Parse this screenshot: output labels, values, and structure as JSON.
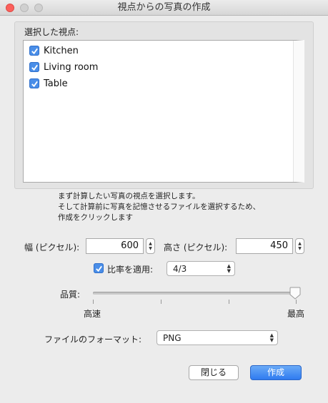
{
  "window": {
    "title": "視点からの写真の作成"
  },
  "viewpoints": {
    "label": "選択した視点:",
    "items": [
      {
        "label": "Kitchen",
        "checked": true
      },
      {
        "label": "Living room",
        "checked": true
      },
      {
        "label": "Table",
        "checked": true
      }
    ]
  },
  "help": {
    "line1": "まず計算したい写真の視点を選択します。",
    "line2": "そして計算前に写真を記憶させるファイルを選択するため、",
    "line3": "作成をクリックします"
  },
  "size": {
    "width_label": "幅 (ピクセル):",
    "width_value": "600",
    "height_label": "高さ (ピクセル):",
    "height_value": "450"
  },
  "ratio": {
    "label": "比率を適用:",
    "checked": true,
    "value": "4/3"
  },
  "quality": {
    "label": "品質:",
    "min_label": "高速",
    "max_label": "最高",
    "level": 1.0
  },
  "format": {
    "label": "ファイルのフォーマット:",
    "value": "PNG"
  },
  "buttons": {
    "close": "閉じる",
    "create": "作成"
  },
  "colors": {
    "accent": "#2f7bf0",
    "close_light": "#fc605c"
  }
}
